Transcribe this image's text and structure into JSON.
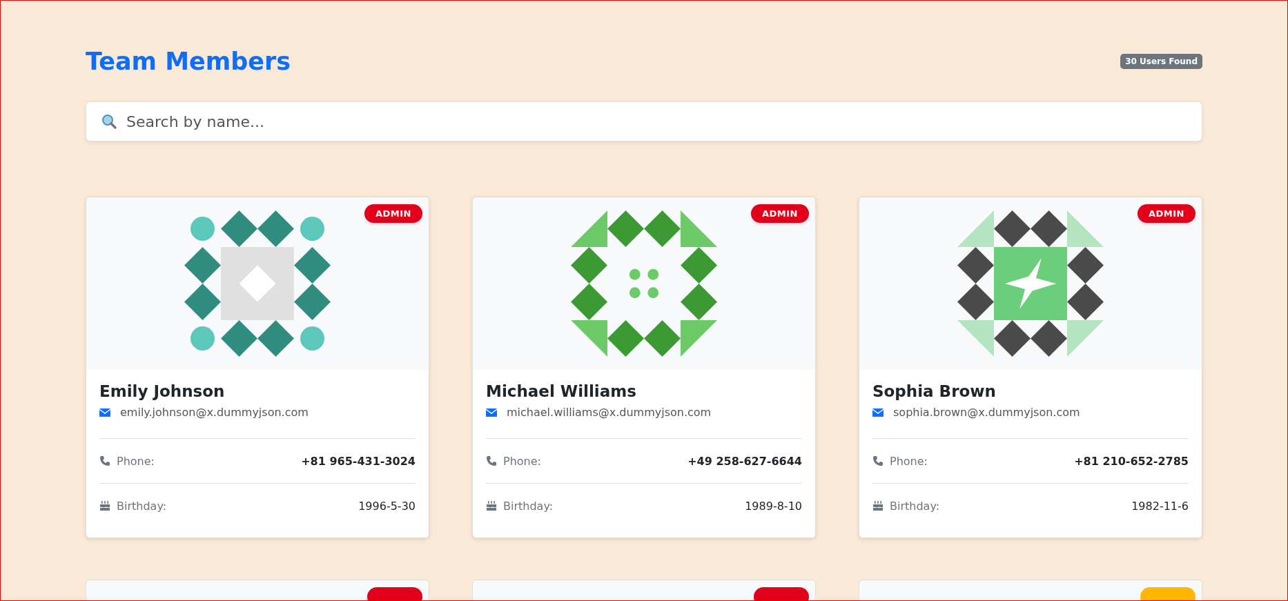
{
  "header": {
    "title": "Team Members",
    "count_badge": "30 Users Found"
  },
  "search": {
    "placeholder": "Search by name..."
  },
  "users": [
    {
      "name": "Emily Johnson",
      "email": "emily.johnson@x.dummyjson.com",
      "phone_label": "Phone:",
      "phone": "+81 965-431-3024",
      "birthday_label": "Birthday:",
      "birthday": "1996-5-30",
      "role_badge": "ADMIN",
      "color": "#e3001b"
    },
    {
      "name": "Michael Williams",
      "email": "michael.williams@x.dummyjson.com",
      "phone_label": "Phone:",
      "phone": "+49 258-627-6644",
      "birthday_label": "Birthday:",
      "birthday": "1989-8-10",
      "role_badge": "ADMIN",
      "color": "#e3001b"
    },
    {
      "name": "Sophia Brown",
      "email": "sophia.brown@x.dummyjson.com",
      "phone_label": "Phone:",
      "phone": "+81 210-652-2785",
      "birthday_label": "Birthday:",
      "birthday": "1982-11-6",
      "role_badge": "ADMIN",
      "color": "#e3001b"
    }
  ],
  "more_users": [
    {
      "color": "#e3001b"
    },
    {
      "color": "#e3001b"
    },
    {
      "color": "#ffb703"
    }
  ]
}
